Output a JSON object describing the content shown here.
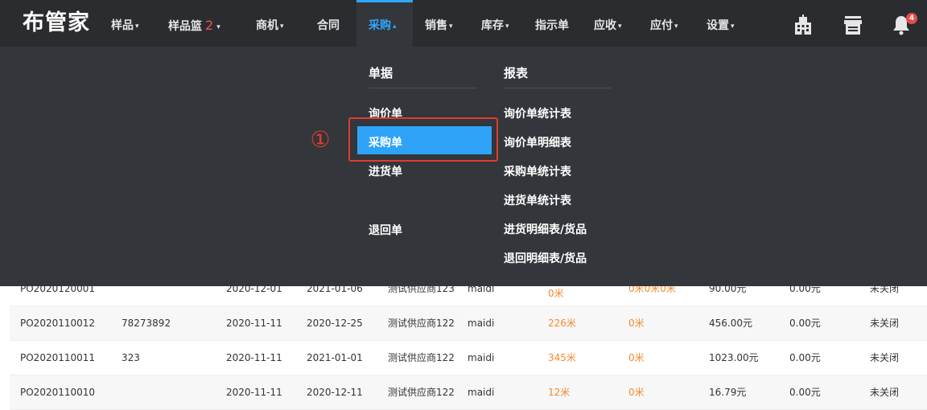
{
  "app": {
    "logo": "布管家"
  },
  "nav": {
    "items": [
      {
        "label": "样品",
        "caret": "▾"
      },
      {
        "label": "样品篮",
        "badge": "2",
        "caret": "▾"
      },
      {
        "label": "商机",
        "caret": "▾"
      },
      {
        "label": "合同",
        "caret": ""
      },
      {
        "label": "采购",
        "caret": "▴"
      },
      {
        "label": "销售",
        "caret": "▾"
      },
      {
        "label": "库存",
        "caret": "▾"
      },
      {
        "label": "指示单",
        "caret": ""
      },
      {
        "label": "应收",
        "caret": "▾"
      },
      {
        "label": "应付",
        "caret": "▾"
      },
      {
        "label": "设置",
        "caret": "▾"
      }
    ],
    "active": "采购",
    "icons": [
      "building-icon",
      "store-icon",
      "bell-icon"
    ],
    "notification_count": "4"
  },
  "dropdown": {
    "documents": {
      "heading": "单据",
      "items": [
        "询价单",
        "采购单",
        "进货单",
        "退回单"
      ],
      "highlighted": "采购单"
    },
    "reports": {
      "heading": "报表",
      "items": [
        "询价单统计表",
        "询价单明细表",
        "采购单统计表",
        "进货单统计表",
        "进货明细表/货品",
        "退回明细表/货品"
      ]
    }
  },
  "annotation": {
    "step": "①",
    "color": "#e23b2e"
  },
  "table": {
    "rows": [
      [
        "PO2020120001",
        "",
        "2020-12-01",
        "2021-01-06",
        "测试供应商123",
        "maidi",
        "0米",
        "0米0米0米",
        "90.00元",
        "0.00元",
        "未关闭"
      ],
      [
        "PO2020110012",
        "78273892",
        "2020-11-11",
        "2020-12-25",
        "测试供应商122",
        "maidi",
        "226米",
        "0米",
        "456.00元",
        "0.00元",
        "未关闭"
      ],
      [
        "PO2020110011",
        "323",
        "2020-11-11",
        "2021-01-01",
        "测试供应商122",
        "maidi",
        "345米",
        "0米",
        "1023.00元",
        "0.00元",
        "未关闭"
      ],
      [
        "PO2020110010",
        "",
        "2020-11-11",
        "2020-12-11",
        "测试供应商122",
        "maidi",
        "12米",
        "0米",
        "16.79元",
        "0.00元",
        "未关闭"
      ]
    ]
  },
  "colors": {
    "nav_bg": "#2a2c2f",
    "dropdown_bg": "#33363a",
    "accent_blue": "#2ea3f7",
    "orange_text": "#f28a30",
    "annotation_red": "#e23b2e"
  }
}
